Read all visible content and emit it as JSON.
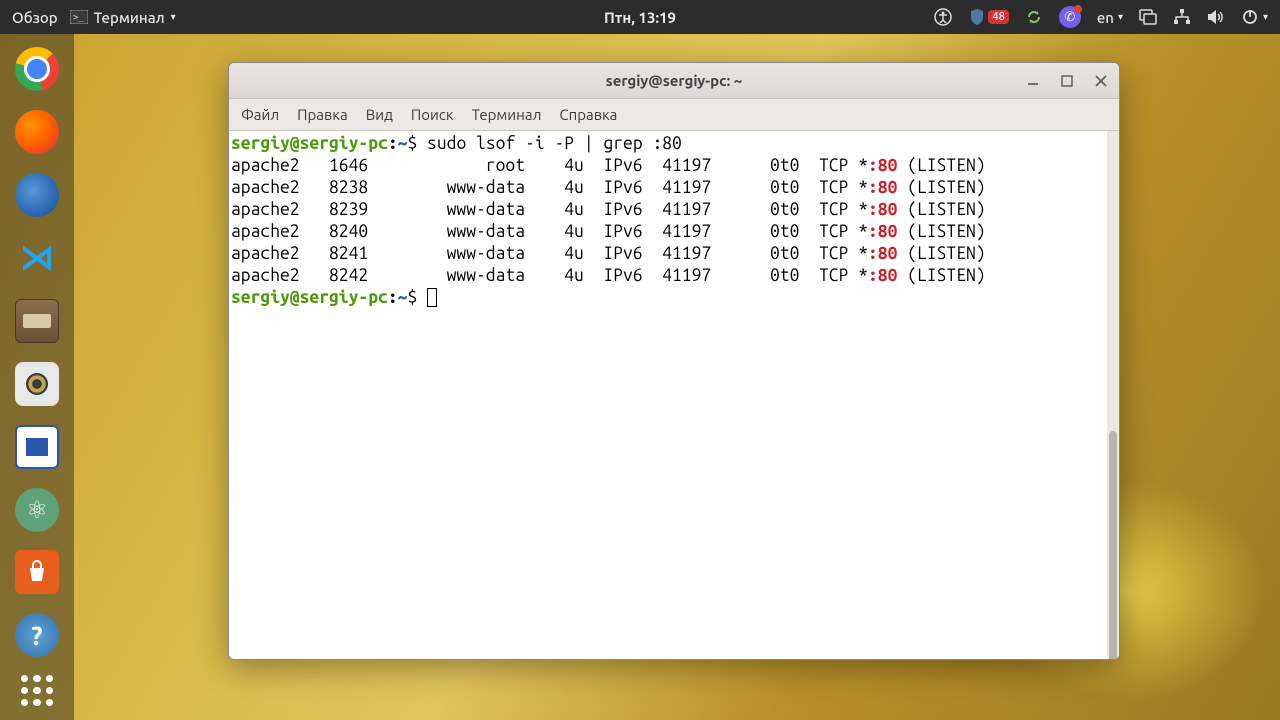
{
  "top_panel": {
    "activities": "Обзор",
    "app_menu": "Терминал",
    "clock": "Птн, 13:19",
    "update_badge": "48",
    "input_lang": "en"
  },
  "dock": {
    "items": [
      "chromium",
      "firefox",
      "thunderbird",
      "vscode",
      "files",
      "rhythmbox",
      "libreoffice-writer",
      "atom",
      "ubuntu-software",
      "help"
    ]
  },
  "window": {
    "title": "sergiy@sergiy-pc: ~",
    "menu": {
      "file": "Файл",
      "edit": "Правка",
      "view": "Вид",
      "search": "Поиск",
      "terminal": "Терминал",
      "help": "Справка"
    }
  },
  "terminal": {
    "prompt_user": "sergiy@sergiy-pc",
    "prompt_colon": ":",
    "prompt_path": "~",
    "prompt_dollar": "$ ",
    "command": "sudo lsof -i -P | grep :80",
    "output_prefix": "apache2   ",
    "output_rows": [
      {
        "pid": "1646",
        "user": "          root",
        "rest1": "    4u  IPv6  41197      0t0  TCP *",
        "port": ":80",
        "listen": " (LISTEN)"
      },
      {
        "pid": "8238",
        "user": "      www-data",
        "rest1": "    4u  IPv6  41197      0t0  TCP *",
        "port": ":80",
        "listen": " (LISTEN)"
      },
      {
        "pid": "8239",
        "user": "      www-data",
        "rest1": "    4u  IPv6  41197      0t0  TCP *",
        "port": ":80",
        "listen": " (LISTEN)"
      },
      {
        "pid": "8240",
        "user": "      www-data",
        "rest1": "    4u  IPv6  41197      0t0  TCP *",
        "port": ":80",
        "listen": " (LISTEN)"
      },
      {
        "pid": "8241",
        "user": "      www-data",
        "rest1": "    4u  IPv6  41197      0t0  TCP *",
        "port": ":80",
        "listen": " (LISTEN)"
      },
      {
        "pid": "8242",
        "user": "      www-data",
        "rest1": "    4u  IPv6  41197      0t0  TCP *",
        "port": ":80",
        "listen": " (LISTEN)"
      }
    ]
  }
}
